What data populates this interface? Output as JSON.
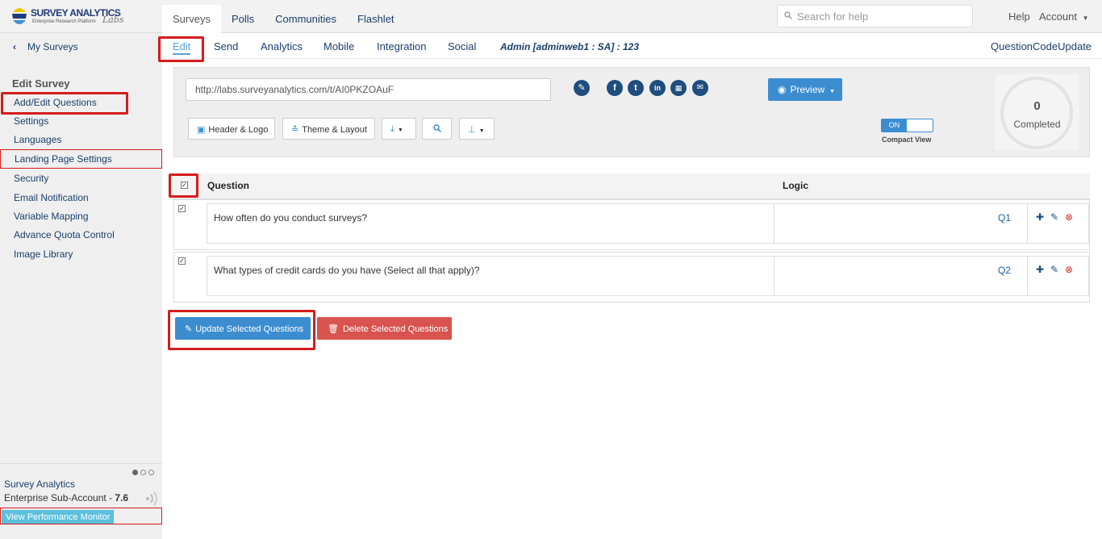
{
  "brand": {
    "name": "SURVEY ANALYTICS",
    "tagline": "Enterprise Research Platform",
    "labs": "Labs"
  },
  "main_tabs": [
    {
      "label": "Surveys",
      "active": true
    },
    {
      "label": "Polls"
    },
    {
      "label": "Communities"
    },
    {
      "label": "Flashlet"
    }
  ],
  "search": {
    "placeholder": "Search for help"
  },
  "header_links": {
    "help": "Help",
    "account": "Account"
  },
  "subnav": {
    "back_label": "My Surveys",
    "tabs": [
      {
        "label": "Edit",
        "active": true
      },
      {
        "label": "Send"
      },
      {
        "label": "Analytics"
      },
      {
        "label": "Mobile"
      },
      {
        "label": "Integration"
      },
      {
        "label": "Social"
      }
    ],
    "admin_label": "Admin [adminweb1 : SA] : 123",
    "right_link": "QuestionCodeUpdate"
  },
  "sidebar": {
    "title": "Edit Survey",
    "items": [
      {
        "label": "Add/Edit Questions"
      },
      {
        "label": "Settings"
      },
      {
        "label": "Languages"
      },
      {
        "label": "Landing Page Settings"
      },
      {
        "label": "Security"
      },
      {
        "label": "Email Notification"
      },
      {
        "label": "Variable Mapping"
      },
      {
        "label": "Advance Quota Control"
      },
      {
        "label": "Image Library"
      }
    ],
    "footer": {
      "account_name": "Survey Analytics",
      "sub_account_label": "Enterprise Sub-Account - ",
      "version": "7.6",
      "perf_button": "View Performance Monitor"
    }
  },
  "panel": {
    "survey_url": "http://labs.surveyanalytics.com/t/AI0PKZOAuF",
    "preview_label": "Preview",
    "buttons": {
      "header_logo": "Header & Logo",
      "theme_layout": "Theme & Layout"
    },
    "compact_view": {
      "state": "ON",
      "label": "Compact View"
    },
    "completed": {
      "count": "0",
      "label": "Completed"
    }
  },
  "table": {
    "headers": {
      "question": "Question",
      "logic": "Logic"
    },
    "rows": [
      {
        "text": "How often do you conduct surveys?",
        "code": "Q1",
        "checked": true
      },
      {
        "text": "What types of credit cards do you have (Select all that apply)?",
        "code": "Q2",
        "checked": true
      }
    ]
  },
  "actions": {
    "update_label": "Update Selected Questions",
    "delete_label": "Delete Selected Questions"
  },
  "colors": {
    "primary": "#3c8dd0",
    "danger": "#d9534f",
    "highlight": "#d51c1c",
    "navy": "#1b3f6b"
  },
  "icons": {
    "share": [
      "edit-icon",
      "facebook-icon",
      "twitter-icon",
      "linkedin-icon",
      "qr-code-icon",
      "email-icon"
    ]
  }
}
